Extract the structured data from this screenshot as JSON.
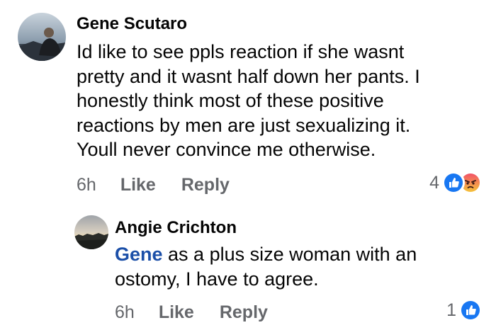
{
  "comments": [
    {
      "author": "Gene Scutaro",
      "lines": [
        "Id like to see ppls reaction if she wasnt",
        "pretty and it wasnt half down her pants. I",
        "honestly think most of these positive",
        "reactions by men are just sexualizing it.",
        "Youll never convince me otherwise."
      ],
      "time": "6h",
      "like_label": "Like",
      "reply_label": "Reply",
      "reaction_count": "4",
      "reactions": [
        "like-icon",
        "angry-icon"
      ]
    },
    {
      "author": "Angie Crichton",
      "mention": "Gene",
      "lines": [
        " as a plus size woman with an",
        "ostomy, I have to agree."
      ],
      "time": "6h",
      "like_label": "Like",
      "reply_label": "Reply",
      "reaction_count": "1",
      "reactions": [
        "like-icon"
      ]
    }
  ],
  "colors": {
    "text": "#050505",
    "secondary": "#65676b",
    "mention": "#1b4fa8",
    "like_blue": "#1877f2",
    "angry_top": "#f25268",
    "angry_bottom": "#f5c33b"
  }
}
